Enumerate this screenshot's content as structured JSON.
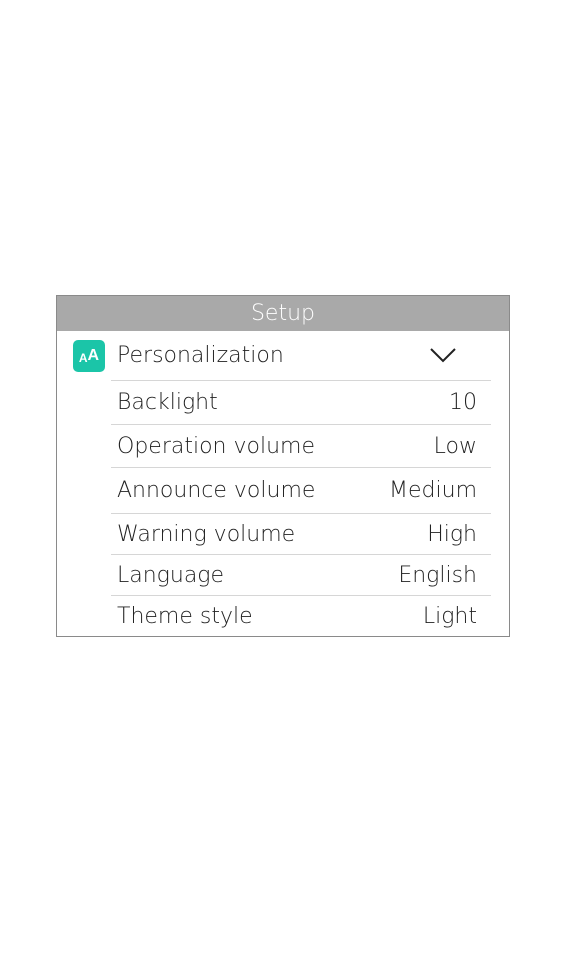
{
  "window": {
    "title": "Setup"
  },
  "section": {
    "icon": "text-size-icon",
    "icon_text_small": "A",
    "icon_text_large": "A",
    "accent_color": "#1bc5a8",
    "label": "Personalization",
    "expand_icon": "chevron-down-icon"
  },
  "settings": [
    {
      "label": "Backlight",
      "value": "10"
    },
    {
      "label": "Operation volume",
      "value": "Low"
    },
    {
      "label": "Announce volume",
      "value": "Medium"
    },
    {
      "label": "Warning volume",
      "value": "High"
    },
    {
      "label": "Language",
      "value": "English"
    },
    {
      "label": "Theme style",
      "value": "Light"
    }
  ]
}
